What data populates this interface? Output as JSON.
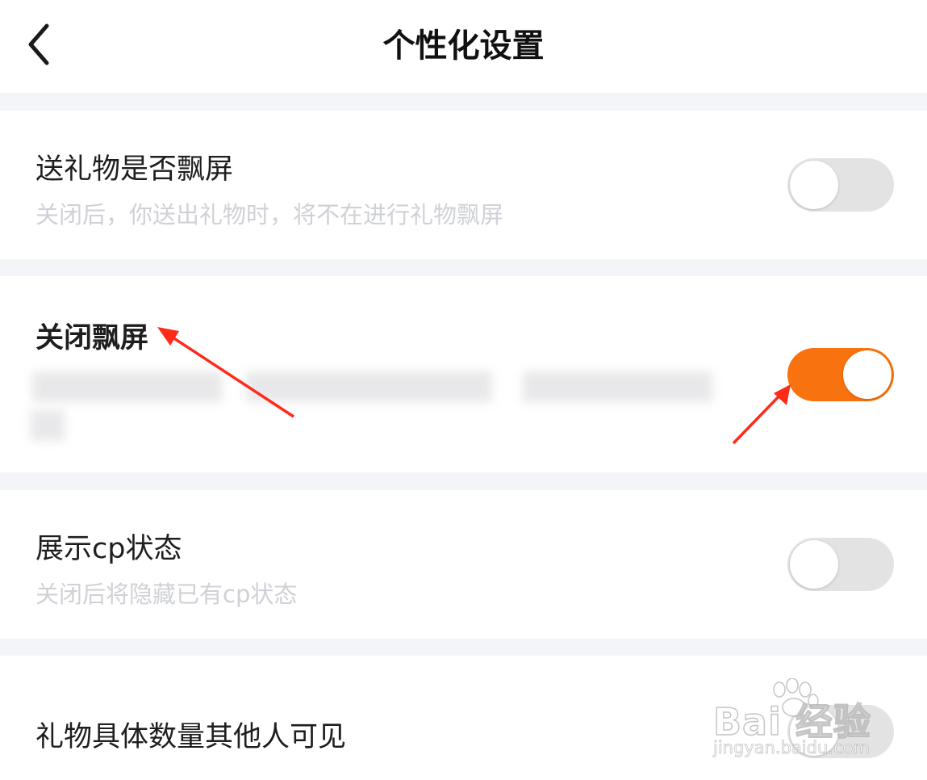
{
  "header": {
    "title": "个性化设置",
    "back_icon": "chevron-left-icon"
  },
  "settings": [
    {
      "title": "送礼物是否飘屏",
      "description": "关闭后，你送出礼物时，将不在进行礼物飘屏",
      "enabled": false
    },
    {
      "title": "关闭飘屏",
      "description_blurred": true,
      "enabled": true
    },
    {
      "title": "展示cp状态",
      "description": "关闭后将隐藏已有cp状态",
      "enabled": false
    },
    {
      "title": "礼物具体数量其他人可见",
      "enabled": false
    }
  ],
  "colors": {
    "accent": "#f8730f",
    "toggle_off": "#e3e3e3",
    "divider": "#f4f5f9",
    "annotation_arrow": "#ff2a1a"
  },
  "watermark": {
    "brand": "Bai 经验",
    "url": "jingyan.baidu.com"
  }
}
